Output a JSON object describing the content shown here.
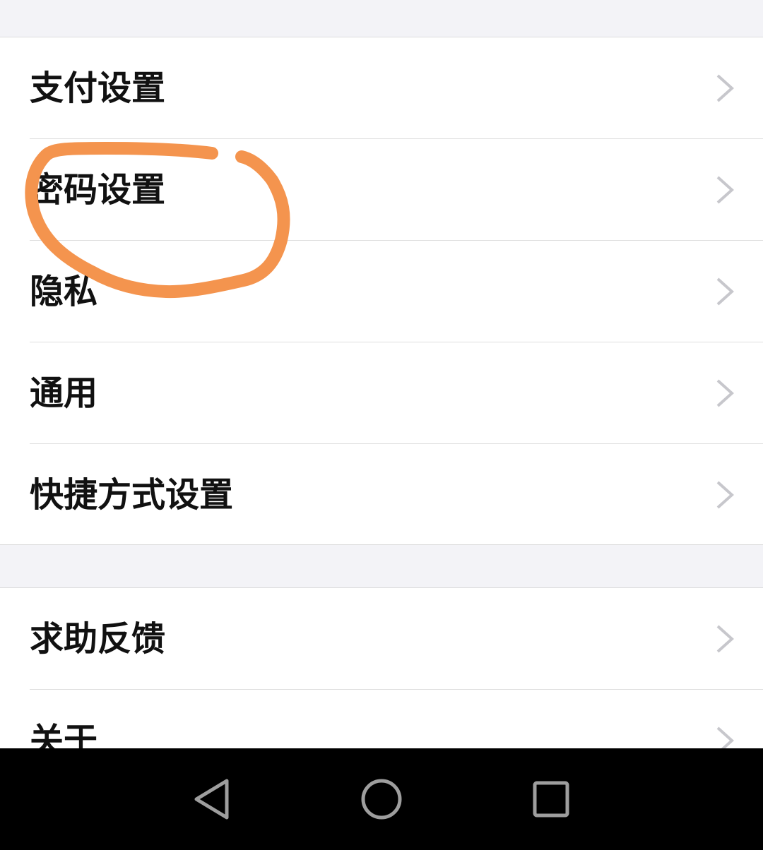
{
  "settings": {
    "group1": [
      {
        "label": "支付设置"
      },
      {
        "label": "密码设置"
      },
      {
        "label": "隐私"
      },
      {
        "label": "通用"
      },
      {
        "label": "快捷方式设置"
      }
    ],
    "group2": [
      {
        "label": "求助反馈"
      },
      {
        "label": "关于"
      }
    ]
  },
  "icons": {
    "row_arrow": "chevron-right-icon",
    "nav_back": "back-triangle-icon",
    "nav_home": "home-circle-icon",
    "nav_recents": "recents-square-icon"
  },
  "colors": {
    "page_background": "#f3f3f7",
    "row_background": "#ffffff",
    "label_text": "#111111",
    "chevron": "#c7c7cc",
    "annotation_stroke": "#f4944e",
    "navbar_background": "#000000",
    "navbar_icon": "#9e9e9e"
  }
}
